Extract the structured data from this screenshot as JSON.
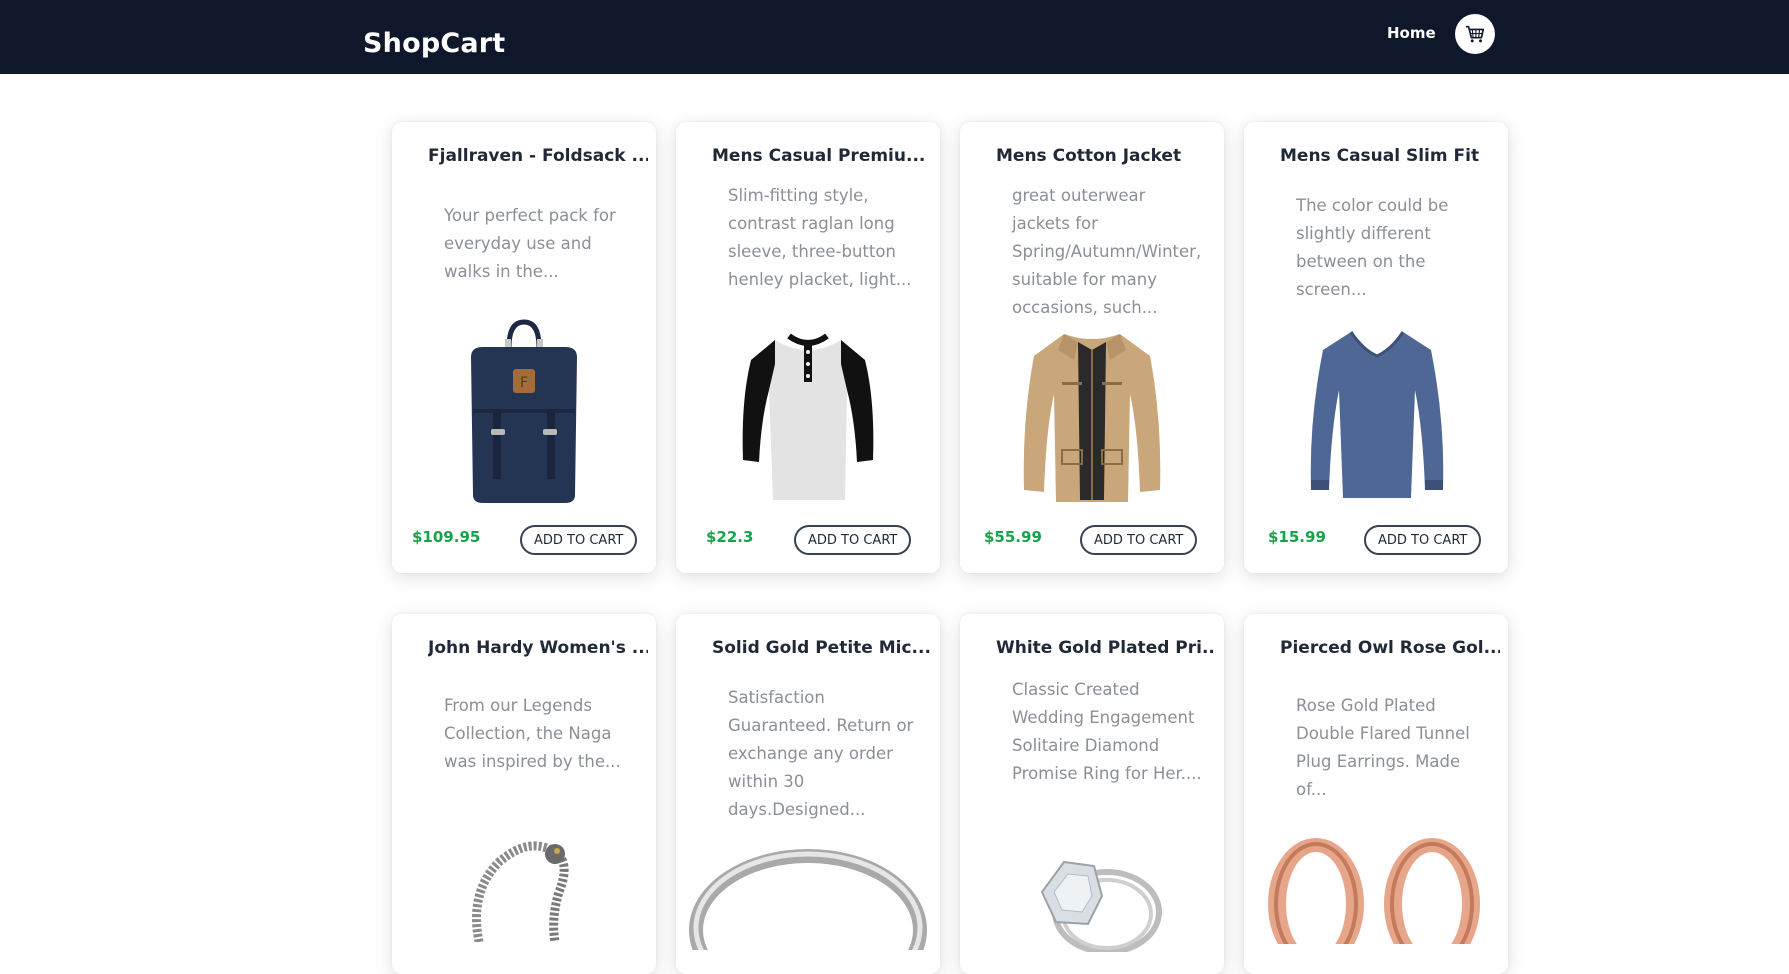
{
  "header": {
    "brand": "ShopCart",
    "nav_home": "Home",
    "cart_icon": "cart-icon"
  },
  "colors": {
    "navbar": "#0f172a",
    "price": "#16a34a",
    "description": "#8a8f98"
  },
  "add_to_cart_label": "ADD TO CART",
  "products": [
    {
      "title": "Fjallraven - Foldsack ...",
      "description": "Your perfect pack for everyday use and walks in the...",
      "price": "$109.95",
      "image": "backpack-image"
    },
    {
      "title": "Mens Casual Premiu...",
      "description": "Slim-fitting style, contrast raglan long sleeve, three-button henley placket, light...",
      "price": "$22.3",
      "image": "raglan-shirt-image"
    },
    {
      "title": "Mens Cotton Jacket",
      "description": "great outerwear jackets for Spring/Autumn/Winter, suitable for many occasions, such...",
      "price": "$55.99",
      "image": "jacket-image"
    },
    {
      "title": "Mens Casual Slim Fit",
      "description": "The color could be slightly different between on the screen...",
      "price": "$15.99",
      "image": "long-sleeve-shirt-image"
    },
    {
      "title": "John Hardy Women's ...",
      "description": "From our Legends Collection, the Naga was inspired by the...",
      "image": "dragon-bracelet-image"
    },
    {
      "title": "Solid Gold Petite Mic...",
      "description": "Satisfaction Guaranteed. Return or exchange any order within 30 days.Designed...",
      "image": "silver-ring-image"
    },
    {
      "title": "White Gold Plated Pri...",
      "description": "Classic Created Wedding Engagement Solitaire Diamond Promise Ring for Her....",
      "image": "diamond-ring-image"
    },
    {
      "title": "Pierced Owl Rose Gol...",
      "description": "Rose Gold Plated Double Flared Tunnel Plug Earrings. Made of...",
      "image": "rose-gold-plugs-image"
    }
  ]
}
